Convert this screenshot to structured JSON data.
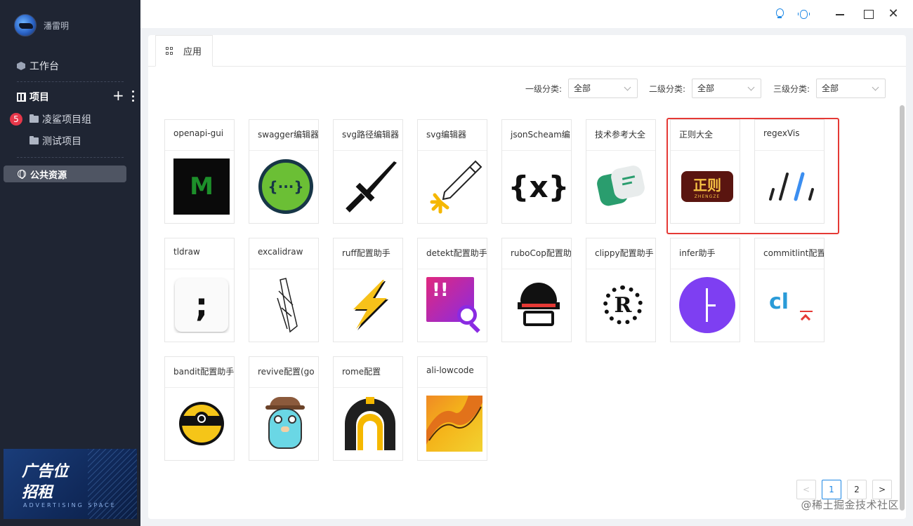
{
  "user": {
    "name": "潘雷明"
  },
  "sidebar": {
    "workbench": "工作台",
    "projects_title": "项目",
    "project_badge": "5",
    "project_items": [
      {
        "label": "凌鲨项目组"
      },
      {
        "label": "测试项目"
      }
    ],
    "public_resources": "公共资源"
  },
  "ad": {
    "line1": "广告位",
    "line2": "招租",
    "line3": "ADVERTISING SPACE"
  },
  "tab": {
    "label": "应用"
  },
  "filters": [
    {
      "label": "一级分类:",
      "value": "全部"
    },
    {
      "label": "二级分类:",
      "value": "全部"
    },
    {
      "label": "三级分类:",
      "value": "全部"
    }
  ],
  "apps": [
    {
      "title": "openapi-gui",
      "icon": "openapi-gui-icon"
    },
    {
      "title": "swagger编辑器",
      "icon": "swagger-icon"
    },
    {
      "title": "svg路径编辑器",
      "icon": "sword-icon"
    },
    {
      "title": "svg编辑器",
      "icon": "pencil-icon"
    },
    {
      "title": "jsonScheam编",
      "icon": "json-schema-icon"
    },
    {
      "title": "技术参考大全",
      "icon": "reference-icon"
    },
    {
      "title": "正则大全",
      "icon": "zhengze-icon"
    },
    {
      "title": "regexVis",
      "icon": "regexvis-icon"
    },
    {
      "title": "tldraw",
      "icon": "tldraw-icon"
    },
    {
      "title": "excalidraw",
      "icon": "excalidraw-icon"
    },
    {
      "title": "ruff配置助手",
      "icon": "lightning-icon"
    },
    {
      "title": "detekt配置助手",
      "icon": "detekt-icon"
    },
    {
      "title": "ruboCop配置助",
      "icon": "rubocop-icon"
    },
    {
      "title": "clippy配置助手",
      "icon": "rust-icon"
    },
    {
      "title": "infer助手",
      "icon": "infer-icon"
    },
    {
      "title": "commitlint配置",
      "icon": "commitlint-icon"
    },
    {
      "title": "bandit配置助手",
      "icon": "bandit-icon"
    },
    {
      "title": "revive配置(go",
      "icon": "gopher-icon"
    },
    {
      "title": "rome配置",
      "icon": "rome-icon"
    },
    {
      "title": "ali-lowcode",
      "icon": "lowcode-icon"
    }
  ],
  "icon_text": {
    "openapi": "M",
    "swagger": "{···}",
    "json": "{x}",
    "zhengze": "正则",
    "zhengze_sub": "ZHENGZE",
    "tldraw": ";",
    "detekt": "!!",
    "rust": "R",
    "commitlint": "cl"
  },
  "pagination": {
    "prev": "<",
    "pages": [
      "1",
      "2"
    ],
    "next": ">"
  },
  "watermark": "@稀土掘金技术社区",
  "colors": {
    "sidebar": "#1f2533",
    "accent": "#1e88e5",
    "highlight": "#e53935"
  }
}
